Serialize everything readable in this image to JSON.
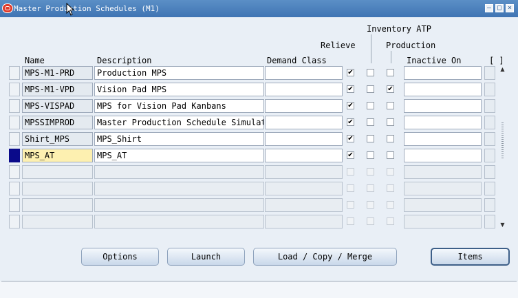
{
  "window": {
    "title": "Master Production Schedules (M1)",
    "buttons": {
      "minimize": "‒",
      "maximize": "□",
      "close": "×"
    }
  },
  "headers": {
    "inventory_atp": "Inventory ATP",
    "relieve": "Relieve",
    "production": "Production",
    "name": "Name",
    "description": "Description",
    "demand_class": "Demand Class",
    "inactive_on": "Inactive On",
    "folder": "[ ]"
  },
  "rows": [
    {
      "name": "MPS-M1-PRD",
      "description": "Production MPS",
      "demand_class": "",
      "relieve": true,
      "inventory_atp": false,
      "production": false,
      "inactive_on": ""
    },
    {
      "name": "MPS-M1-VPD",
      "description": "Vision Pad MPS",
      "demand_class": "",
      "relieve": true,
      "inventory_atp": false,
      "production": true,
      "inactive_on": ""
    },
    {
      "name": "MPS-VISPAD",
      "description": "MPS for Vision Pad Kanbans",
      "demand_class": "",
      "relieve": true,
      "inventory_atp": false,
      "production": false,
      "inactive_on": ""
    },
    {
      "name": "MPSSIMPROD",
      "description": "Master Production Schedule Simulate",
      "demand_class": "",
      "relieve": true,
      "inventory_atp": false,
      "production": false,
      "inactive_on": ""
    },
    {
      "name": "Shirt_MPS",
      "description": "MPS_Shirt",
      "demand_class": "",
      "relieve": true,
      "inventory_atp": false,
      "production": false,
      "inactive_on": ""
    },
    {
      "name": "MPS_AT",
      "description": "MPS_AT",
      "demand_class": "",
      "relieve": true,
      "inventory_atp": false,
      "production": false,
      "inactive_on": ""
    },
    {
      "name": "",
      "description": "",
      "demand_class": "",
      "relieve": false,
      "inventory_atp": false,
      "production": false,
      "inactive_on": ""
    },
    {
      "name": "",
      "description": "",
      "demand_class": "",
      "relieve": false,
      "inventory_atp": false,
      "production": false,
      "inactive_on": ""
    },
    {
      "name": "",
      "description": "",
      "demand_class": "",
      "relieve": false,
      "inventory_atp": false,
      "production": false,
      "inactive_on": ""
    },
    {
      "name": "",
      "description": "",
      "demand_class": "",
      "relieve": false,
      "inventory_atp": false,
      "production": false,
      "inactive_on": ""
    }
  ],
  "active_row": 5,
  "filled_rows": 6,
  "actions": {
    "options": "Options",
    "launch": "Launch",
    "load_copy_merge": "Load / Copy / Merge",
    "items": "Items"
  },
  "colors": {
    "title_bar": "#4a80bd",
    "selected_cell": "#fdf0b0",
    "row_indicator": "#0a0a8a"
  }
}
